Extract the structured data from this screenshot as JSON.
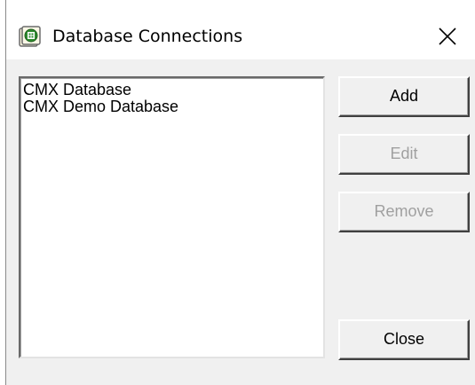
{
  "window": {
    "title": "Database Connections",
    "icon": "database-app-icon",
    "close_icon": "close-icon"
  },
  "list": {
    "items": [
      {
        "label": "CMX Database"
      },
      {
        "label": "CMX Demo Database"
      }
    ]
  },
  "buttons": {
    "add": {
      "label": "Add",
      "enabled": true
    },
    "edit": {
      "label": "Edit",
      "enabled": false
    },
    "remove": {
      "label": "Remove",
      "enabled": false
    },
    "close": {
      "label": "Close",
      "enabled": true
    }
  },
  "colors": {
    "dialog_background": "#f0f0f0",
    "disabled_text": "#a0a0a0",
    "icon_accent": "#2e8b2e"
  }
}
